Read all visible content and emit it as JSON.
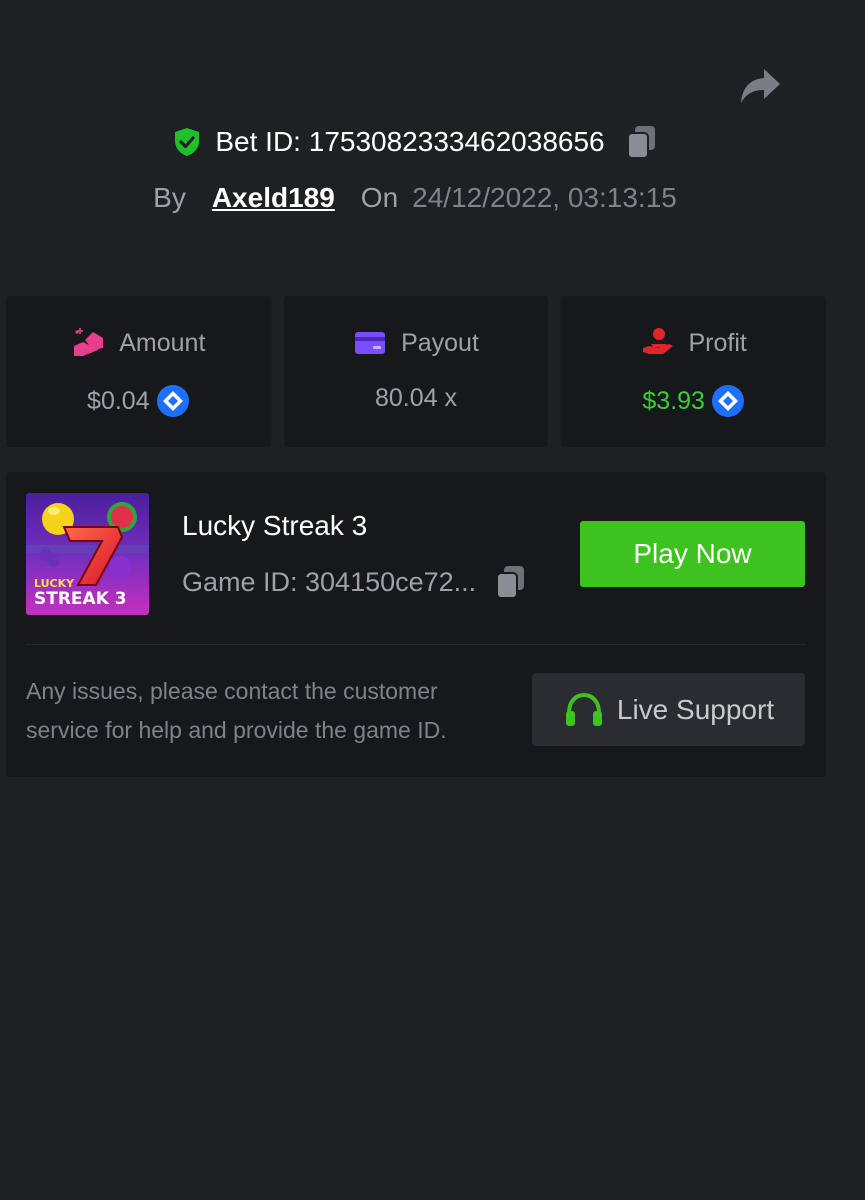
{
  "header": {
    "share_icon": "share-arrow-icon",
    "bet_id_label": "Bet ID: 1753082333462038656",
    "verified_icon": "shield-check-icon",
    "by_label": "By",
    "username": "Axeld189",
    "on_label": "On",
    "datetime": "24/12/2022, 03:13:15"
  },
  "stats": [
    {
      "label": "Amount",
      "icon": "hand-bag-icon",
      "value": "$0.04",
      "coin_icon": "coin-icon",
      "color": "#e83e8c"
    },
    {
      "label": "Payout",
      "icon": "card-icon",
      "value": "80.04 x",
      "color": "#7b4dff"
    },
    {
      "label": "Profit",
      "icon": "hand-person-icon",
      "value": "$3.93",
      "coin_icon": "coin-icon",
      "color": "#e0262b",
      "value_color": "#3dcc3a"
    }
  ],
  "game": {
    "title": "Lucky Streak 3",
    "game_id": "Game ID: 304150ce72...",
    "play_label": "Play Now",
    "thumb_text_top": "LUCKY",
    "thumb_text_bottom": "STREAK 3"
  },
  "support": {
    "help_text": "Any issues, please contact the customer service for help and provide the game ID.",
    "button_label": "Live Support",
    "icon": "headset-icon"
  },
  "colors": {
    "background": "#1f2024",
    "card": "#17181b",
    "accent_green": "#3ec21f",
    "verified_green": "#1fbf2a",
    "coin_blue": "#1f6fff"
  }
}
